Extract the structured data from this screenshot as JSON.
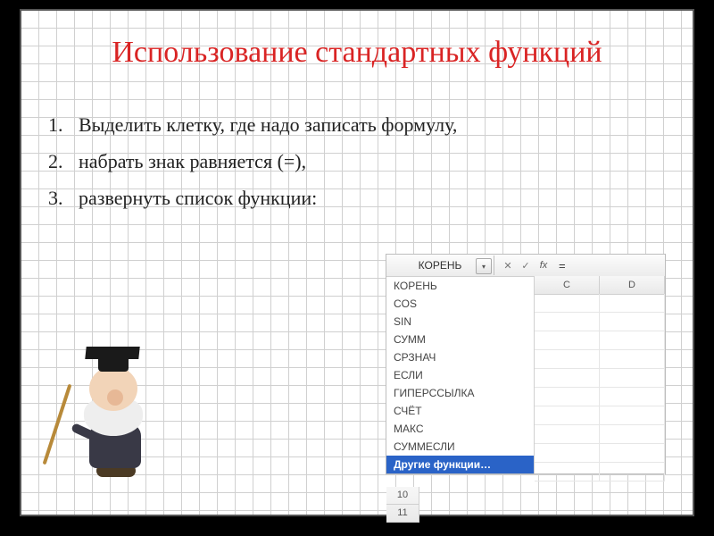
{
  "title": "Использование стандартных функций",
  "steps": [
    {
      "n": "1.",
      "text": "Выделить клетку, где надо записать формулу,"
    },
    {
      "n": "2.",
      "text": " набрать знак равняется (=),"
    },
    {
      "n": "3.",
      "text": " развернуть список функции:"
    }
  ],
  "excel": {
    "namebox_value": "КОРЕНЬ",
    "formula_bar": "=",
    "fx_label": "fx",
    "cancel_glyph": "✕",
    "accept_glyph": "✓",
    "dropdown_glyph": "▾",
    "columns": [
      "C",
      "D"
    ],
    "row_headers": [
      "10",
      "11"
    ],
    "dropdown_items": [
      "КОРЕНЬ",
      "COS",
      "SIN",
      "СУММ",
      "СРЗНАЧ",
      "ЕСЛИ",
      "ГИПЕРССЫЛКА",
      "СЧЁТ",
      "МАКС",
      "СУММЕСЛИ"
    ],
    "dropdown_selected": "Другие функции…"
  }
}
